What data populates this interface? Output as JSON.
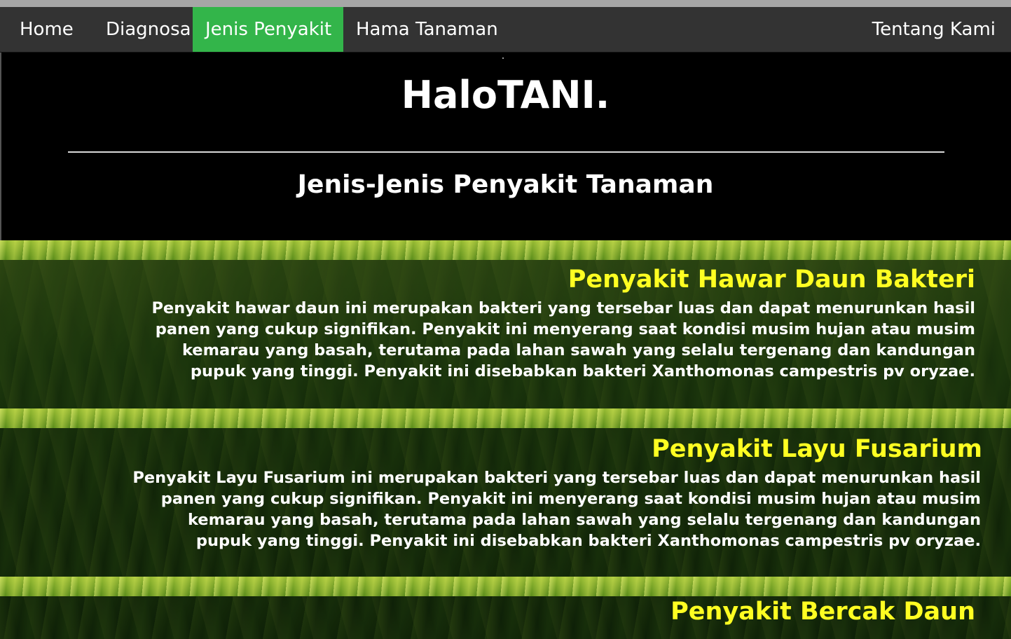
{
  "nav": {
    "items": [
      {
        "label": "Home"
      },
      {
        "label": "Diagnosa"
      },
      {
        "label": "Jenis Penyakit",
        "active": true
      },
      {
        "label": "Hama Tanaman"
      }
    ],
    "right_item": {
      "label": "Tentang Kami"
    },
    "active_color": "#33b54a",
    "bar_color": "#333333"
  },
  "header": {
    "brand": "HaloTANI.",
    "subtitle": "Jenis-Jenis Penyakit Tanaman"
  },
  "diseases": [
    {
      "title": "Penyakit Hawar Daun Bakteri",
      "lines": [
        "Penyakit hawar daun ini merupakan bakteri yang tersebar luas dan dapat menurunkan hasil",
        "panen yang cukup signifikan. Penyakit ini menyerang saat kondisi musim hujan atau musim",
        "kemarau yang basah, terutama pada lahan sawah yang selalu tergenang dan kandungan",
        "pupuk yang tinggi. Penyakit ini disebabkan bakteri Xanthomonas campestris pv oryzae."
      ]
    },
    {
      "title": "Penyakit Layu Fusarium",
      "lines": [
        "Penyakit Layu Fusarium ini merupakan bakteri yang tersebar luas dan dapat menurunkan hasil",
        "panen yang cukup signifikan. Penyakit ini menyerang saat kondisi musim hujan atau musim",
        "kemarau yang basah, terutama pada lahan sawah yang selalu tergenang dan kandungan",
        "pupuk yang tinggi. Penyakit ini disebabkan bakteri Xanthomonas campestris pv oryzae."
      ]
    },
    {
      "title": "Penyakit Bercak Daun",
      "lines": []
    }
  ],
  "colors": {
    "title_yellow": "#ffff22",
    "text_white": "#ffffff"
  }
}
